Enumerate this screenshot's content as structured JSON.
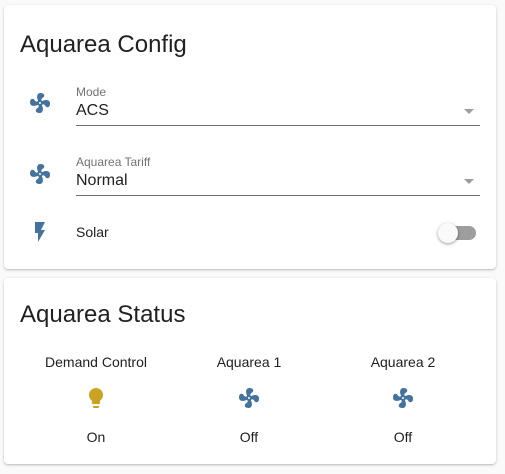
{
  "config": {
    "title": "Aquarea Config",
    "mode": {
      "label": "Mode",
      "value": "ACS",
      "icon": "fan-icon"
    },
    "tariff": {
      "label": "Aquarea Tariff",
      "value": "Normal",
      "icon": "fan-icon"
    },
    "solar": {
      "label": "Solar",
      "icon": "flash-icon",
      "on": false
    }
  },
  "status": {
    "title": "Aquarea Status",
    "entities": [
      {
        "name": "Demand Control",
        "state": "On",
        "icon": "lightbulb-icon",
        "color": "#c9a423"
      },
      {
        "name": "Aquarea 1",
        "state": "Off",
        "icon": "fan-icon",
        "color": "#44739e"
      },
      {
        "name": "Aquarea 2",
        "state": "Off",
        "icon": "fan-icon",
        "color": "#44739e"
      }
    ]
  },
  "colors": {
    "icon": "#44739e",
    "active": "#c9a423"
  }
}
